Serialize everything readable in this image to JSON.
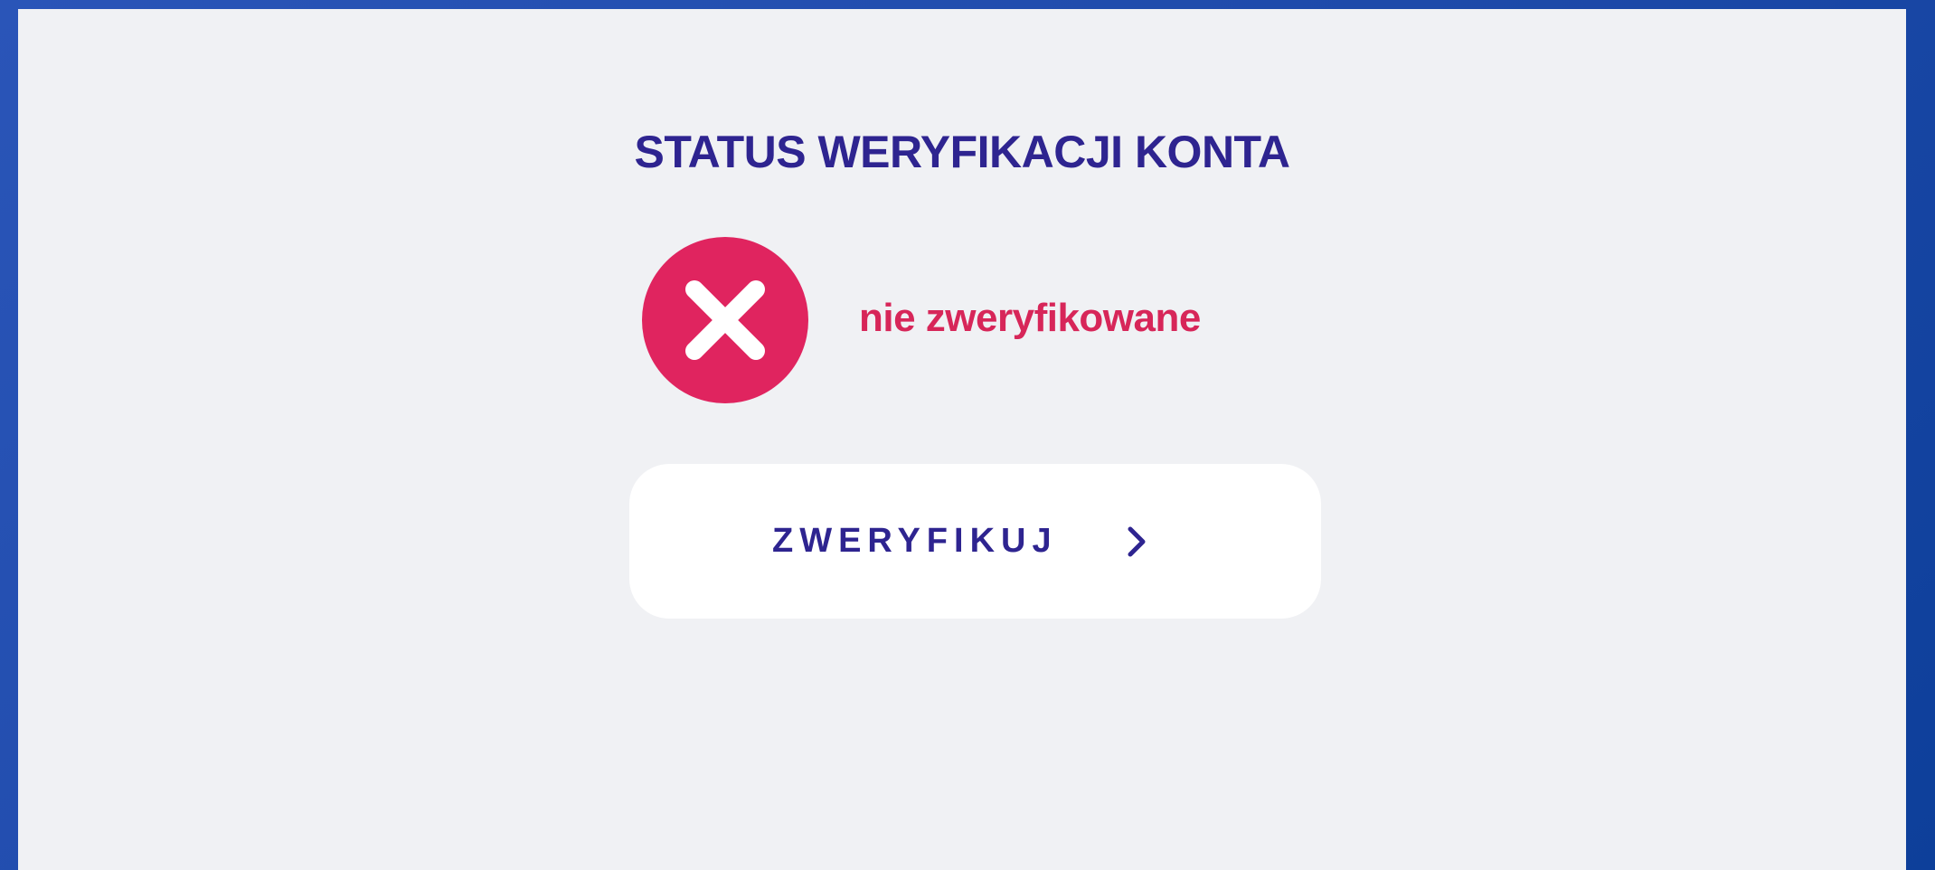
{
  "card": {
    "title": "STATUS WERYFIKACJI KONTA",
    "status": {
      "icon": "close-icon",
      "text": "nie zweryfikowane",
      "color": "#d72659",
      "icon_bg": "#e0245f"
    },
    "button": {
      "label": "ZWERYFIKUJ",
      "icon": "chevron-right-icon"
    }
  },
  "colors": {
    "accent": "#2e2490",
    "background": "#f0f1f4",
    "frame": "#2050b4"
  }
}
